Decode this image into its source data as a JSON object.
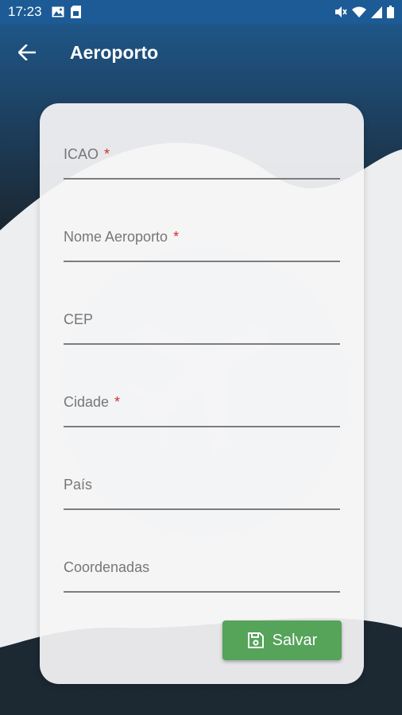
{
  "status_bar": {
    "time": "17:23",
    "left_icons": [
      "image-icon",
      "sim-card-icon"
    ],
    "right_icons": [
      "mute-icon",
      "wifi-icon",
      "signal-icon",
      "battery-icon"
    ]
  },
  "app_bar": {
    "title": "Aeroporto",
    "back_icon": "arrow-left-icon"
  },
  "form": {
    "fields": [
      {
        "label": "ICAO",
        "required": "*",
        "value": ""
      },
      {
        "label": "Nome Aeroporto",
        "required": "*",
        "value": ""
      },
      {
        "label": "CEP",
        "required": "",
        "value": ""
      },
      {
        "label": "Cidade",
        "required": "*",
        "value": ""
      },
      {
        "label": "País",
        "required": "",
        "value": ""
      },
      {
        "label": "Coordenadas",
        "required": "",
        "value": ""
      }
    ],
    "save_label": "Salvar",
    "save_icon": "floppy-disk-icon"
  },
  "colors": {
    "status_bar": "#1c5b96",
    "header_gradient_top": "#1f5a8e",
    "header_gradient_bottom": "#1b2630",
    "required": "#d32f2f",
    "save_button": "#56a35a",
    "background_wave": "#eceef0"
  },
  "background_icon": "airplane-icon"
}
